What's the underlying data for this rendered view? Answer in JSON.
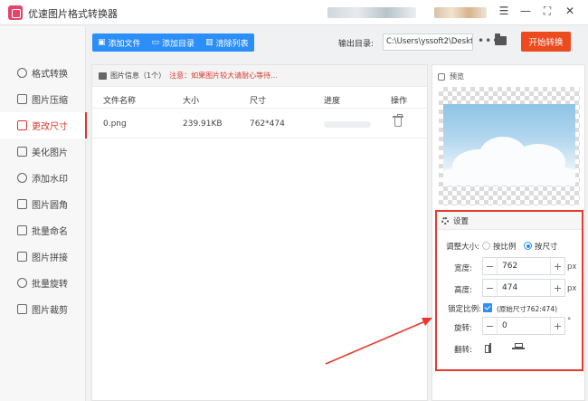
{
  "window": {
    "title": "优速图片格式转换器",
    "controls": [
      "☰",
      "—",
      "⛶",
      "✕"
    ]
  },
  "sidebar": {
    "items": [
      {
        "label": "格式转换",
        "icon": "convert-icon"
      },
      {
        "label": "图片压缩",
        "icon": "compress-icon"
      },
      {
        "label": "更改尺寸",
        "icon": "resize-icon",
        "active": true
      },
      {
        "label": "美化图片",
        "icon": "beautify-icon"
      },
      {
        "label": "添加水印",
        "icon": "watermark-icon"
      },
      {
        "label": "图片圆角",
        "icon": "rounded-corner-icon"
      },
      {
        "label": "批量命名",
        "icon": "rename-icon"
      },
      {
        "label": "图片拼接",
        "icon": "stitch-icon"
      },
      {
        "label": "批量旋转",
        "icon": "rotate-icon"
      },
      {
        "label": "图片裁剪",
        "icon": "crop-icon"
      }
    ]
  },
  "toolbar": {
    "add_file": "添加文件",
    "add_folder": "添加目录",
    "clear_list": "清除列表",
    "output_label": "输出目录:",
    "output_path": "C:\\Users\\yssoft2\\Deskt",
    "dots": "•••",
    "start_label": "开始转换",
    "accent": "#2c8ef8",
    "start_color": "#ec4a1f"
  },
  "file_panel": {
    "header_title": "图片信息",
    "header_count": "（1个）",
    "header_note": "注意：如果图片较大请耐心等待...",
    "columns": {
      "name": "文件名称",
      "size": "大小",
      "dims": "尺寸",
      "progress": "进度",
      "action": "操作"
    },
    "rows": [
      {
        "name": "0.png",
        "size": "239.91KB",
        "dims": "762*474",
        "progress": 0
      }
    ]
  },
  "preview": {
    "title": "预览"
  },
  "settings": {
    "title": "设置",
    "resize_label": "调整大小:",
    "mode_ratio": "按比例",
    "mode_size": "按尺寸",
    "selected_mode": "size",
    "width_label": "宽度:",
    "width_value": "762",
    "height_label": "高度:",
    "height_value": "474",
    "unit_px": "px",
    "lock_label": "锁定比例:",
    "lock_checked": true,
    "original_size": "(原始尺寸762:474)",
    "rotate_label": "旋转:",
    "rotate_value": "0",
    "degree_unit": "°",
    "flip_label": "翻转:",
    "minus": "−",
    "plus": "+",
    "highlight_color": "#e53b2e"
  }
}
